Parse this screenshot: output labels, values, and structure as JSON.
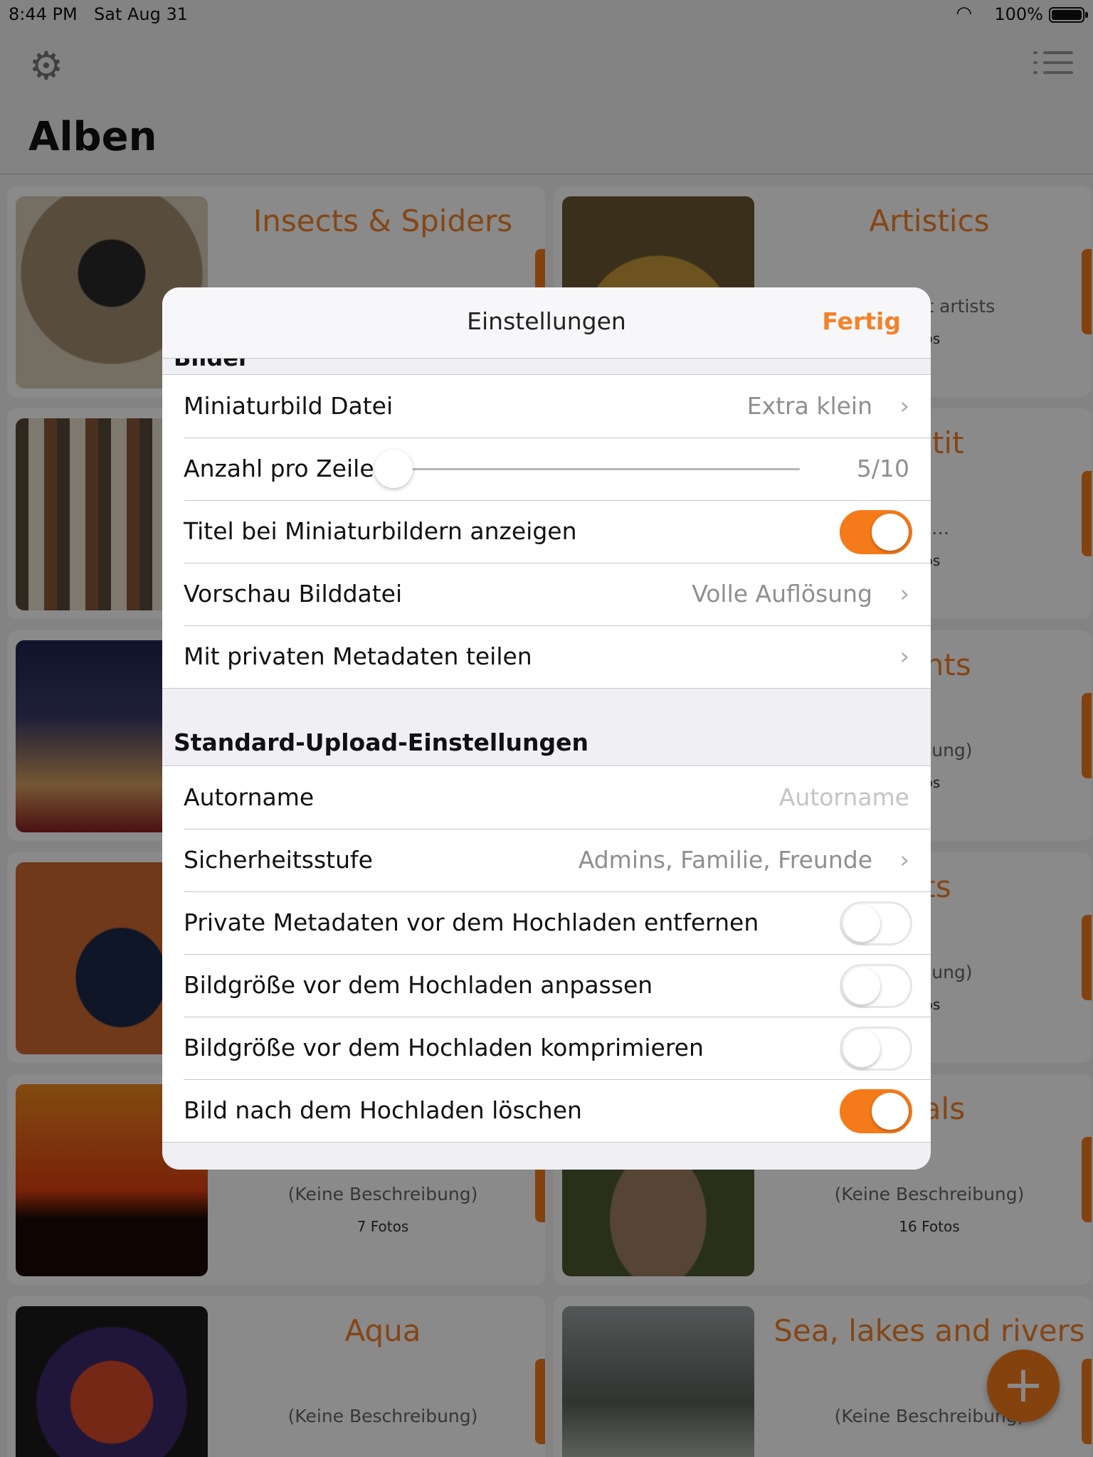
{
  "status_bar": {
    "time": "8:44 PM",
    "date": "Sat Aug 31",
    "battery_percent": "100%"
  },
  "nav": {
    "title": "Alben"
  },
  "albums": [
    {
      "name": "Insects & Spiders",
      "description": "",
      "count": "",
      "thumb_color": "#bca78c"
    },
    {
      "name": "Artistics",
      "description": "m great artists",
      "count": "tos",
      "thumb_color": "#8a6b2c"
    },
    {
      "name": "",
      "description": "",
      "count": "",
      "thumb_color": "#8d7a5a"
    },
    {
      "name": "pétit",
      "description": "od…",
      "count": "tos",
      "thumb_color": "#b08a4a"
    },
    {
      "name": "",
      "description": "",
      "count": "",
      "thumb_color": "#2a3260"
    },
    {
      "name": "nents",
      "description": "hreibung)",
      "count": "tos",
      "thumb_color": "#6f6f6f"
    },
    {
      "name": "",
      "description": "",
      "count": "",
      "thumb_color": "#c75c2c"
    },
    {
      "name": "cts",
      "description": "hreibung)",
      "count": "tos",
      "thumb_color": "#5a6a5a"
    },
    {
      "name": "",
      "description": "(Keine Beschreibung)",
      "count": "7 Fotos",
      "thumb_color": "#e26a1a"
    },
    {
      "name": "mals",
      "description": "(Keine Beschreibung)",
      "count": "16 Fotos",
      "thumb_color": "#7a6a50"
    },
    {
      "name": "Aqua",
      "description": "(Keine Beschreibung)",
      "count": "",
      "thumb_color": "#8a2a2a"
    },
    {
      "name": "Sea, lakes and rivers",
      "description": "(Keine Beschreibung)",
      "count": "",
      "thumb_color": "#6a7068"
    }
  ],
  "settings": {
    "title": "Einstellungen",
    "done_label": "Fertig",
    "clipped_heading": "Bilder",
    "images": {
      "thumbnail_file": {
        "label": "Miniaturbild Datei",
        "value": "Extra klein"
      },
      "per_row": {
        "label": "Anzahl pro Zeile",
        "value": "5/10",
        "fraction": 0.0
      },
      "show_titles": {
        "label": "Titel bei Miniaturbildern anzeigen",
        "on": true
      },
      "preview_file": {
        "label": "Vorschau Bilddatei",
        "value": "Volle Auflösung"
      },
      "share_private": {
        "label": "Mit privaten Metadaten teilen"
      }
    },
    "upload_section_title": "Standard-Upload-Einstellungen",
    "upload": {
      "author": {
        "label": "Autorname",
        "placeholder": "Autorname"
      },
      "privacy": {
        "label": "Sicherheitsstufe",
        "value": "Admins, Familie, Freunde"
      },
      "strip_metadata": {
        "label": "Private Metadaten vor dem Hochladen entfernen",
        "on": false
      },
      "resize": {
        "label": "Bildgröße vor dem Hochladen anpassen",
        "on": false
      },
      "compress": {
        "label": "Bildgröße vor dem Hochladen komprimieren",
        "on": false
      },
      "delete_after": {
        "label": "Bild nach dem Hochladen löschen",
        "on": true
      }
    }
  },
  "colors": {
    "accent": "#f47a1a",
    "separator": "#c8c8cc",
    "secondary_text": "#8e8e93"
  },
  "icons": {
    "settings": "gear-icon",
    "menu": "list-icon",
    "add": "plus-icon",
    "chevron": "chevron-right-icon"
  }
}
